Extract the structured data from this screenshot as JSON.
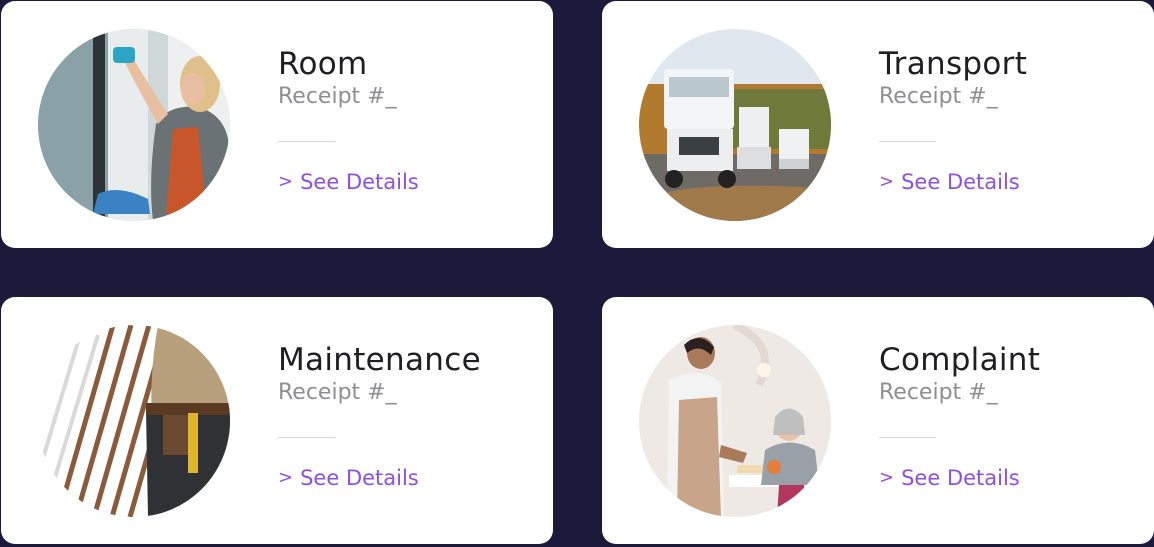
{
  "cards": [
    {
      "title": "Room",
      "receipt": "Receipt #_",
      "link": "See Details",
      "photo_icon": "housekeeping-photo"
    },
    {
      "title": "Transport",
      "receipt": "Receipt #_",
      "link": "See Details",
      "photo_icon": "trucks-photo"
    },
    {
      "title": "Maintenance",
      "receipt": "Receipt #_",
      "link": "See Details",
      "photo_icon": "tool-belt-photo"
    },
    {
      "title": "Complaint",
      "receipt": "Receipt #_",
      "link": "See Details",
      "photo_icon": "restaurant-photo"
    }
  ],
  "colors": {
    "background": "#1c1a3b",
    "card": "#ffffff",
    "title": "#1f1f23",
    "muted": "#8f8f93",
    "accent": "#8e4fe6"
  },
  "icons": {
    "link_chevron": "chevron-right-icon"
  }
}
